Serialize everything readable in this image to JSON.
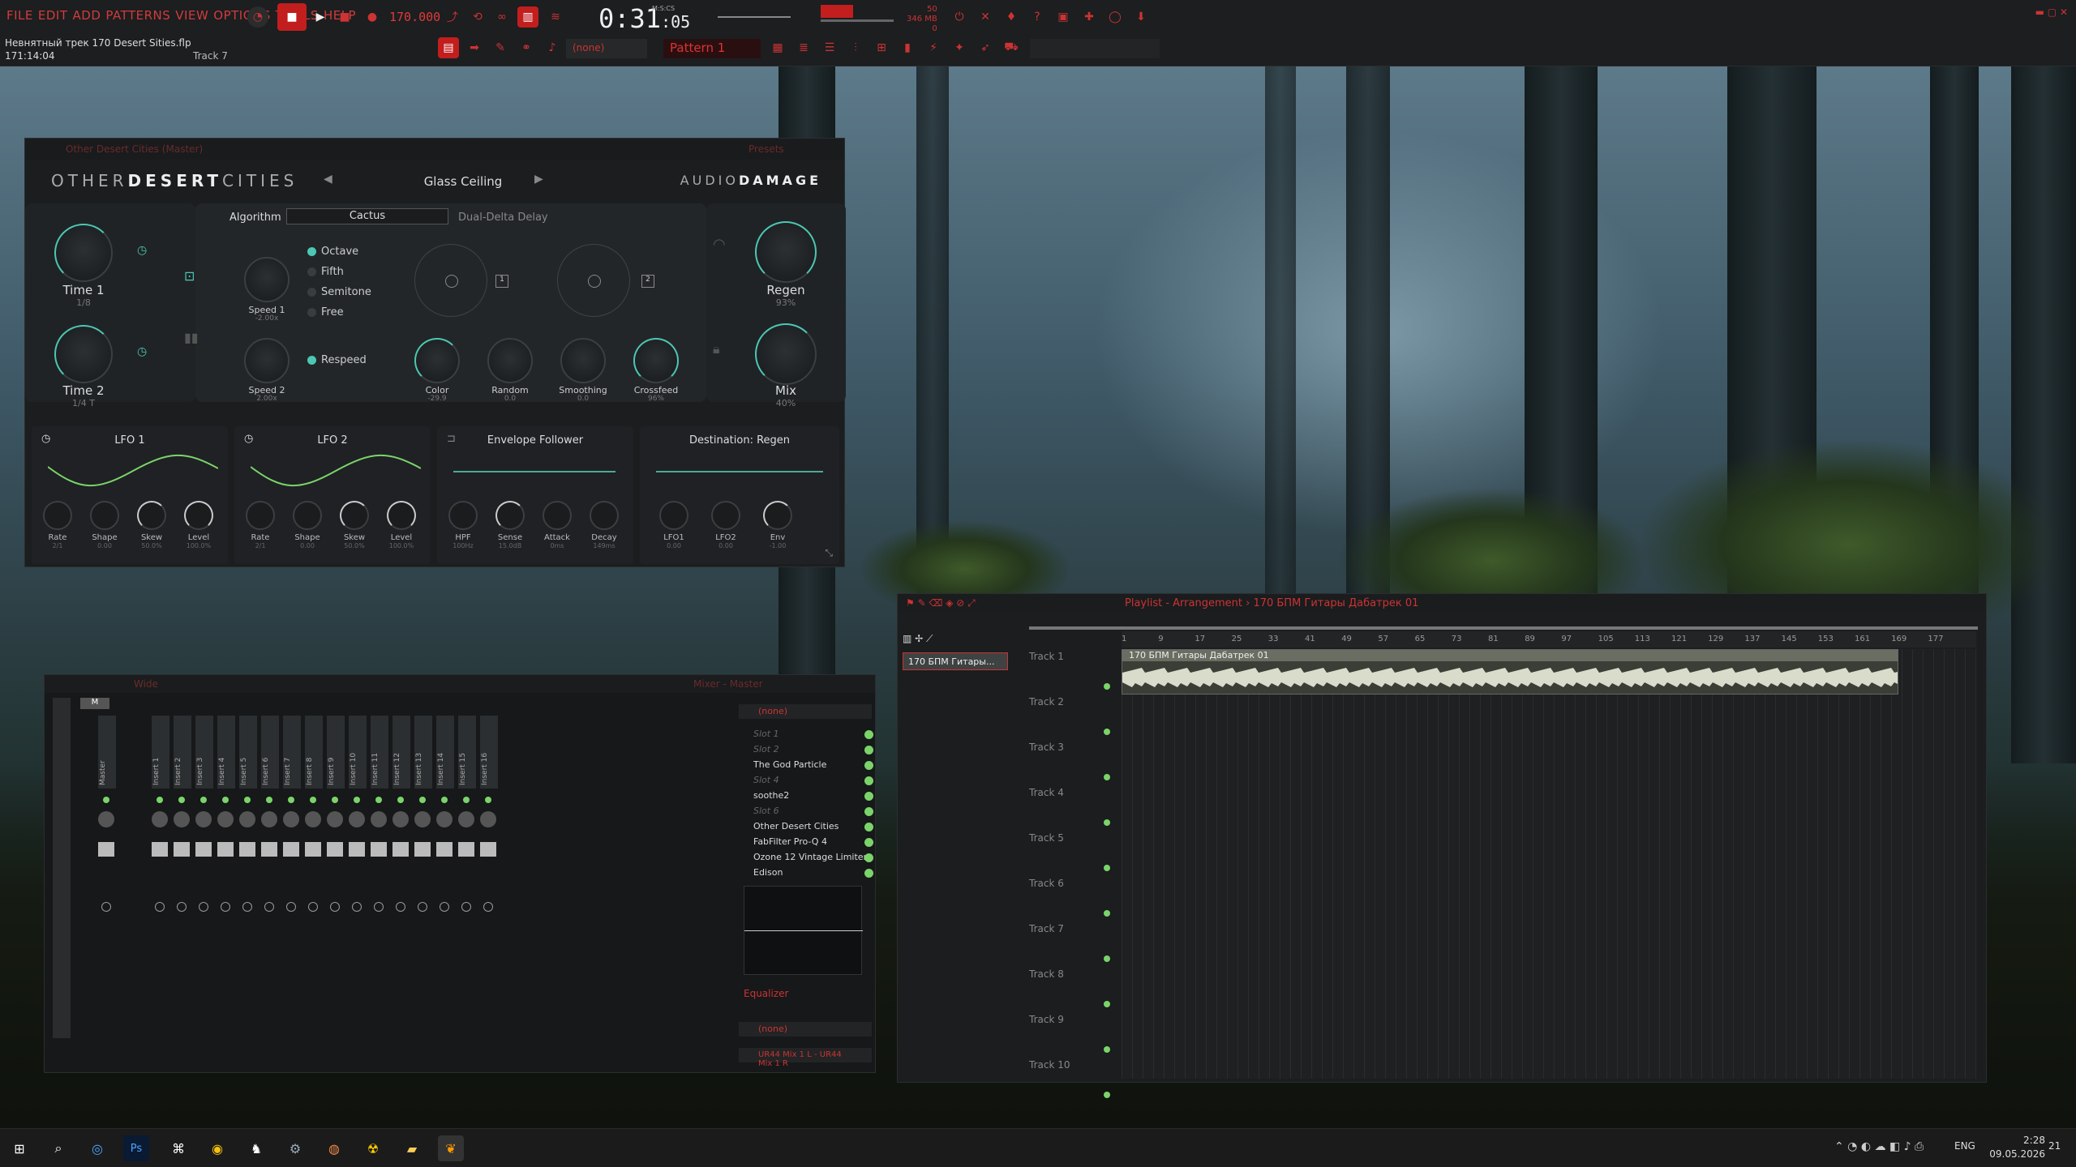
{
  "topbar": {
    "menu": [
      "FILE",
      "EDIT",
      "ADD",
      "PATTERNS",
      "VIEW",
      "OPTIONS",
      "TOOLS",
      "HELP"
    ],
    "project_name": "Невнятный трек 170 Desert Sities.flp",
    "project_time": "171:14:04",
    "track_hint": "Track 7",
    "bpm": "170.000",
    "time_main": "0:31",
    "time_sub": "05",
    "time_label": "M:S:CS",
    "pattern": "Pattern 1",
    "none_label": "(none)",
    "cpu_label": "50",
    "mem_label": "346 MB",
    "mem_val": "0"
  },
  "plugin": {
    "window_title": "Other Desert Cities (Master)",
    "presets_label": "Presets",
    "brand_left_a": "OTHER",
    "brand_left_b": "DESERT",
    "brand_left_c": "CITIES",
    "brand_right_a": "AUDIO",
    "brand_right_b": "DAMAGE",
    "preset_name": "Glass Ceiling",
    "algorithm_label": "Algorithm",
    "algorithm_value": "Cactus",
    "algorithm_desc": "Dual-Delta Delay",
    "time1": {
      "label": "Time 1",
      "value": "1/8"
    },
    "time2": {
      "label": "Time 2",
      "value": "1/4 T"
    },
    "regen": {
      "label": "Regen",
      "value": "93%"
    },
    "mix": {
      "label": "Mix",
      "value": "40%"
    },
    "speed1": {
      "label": "Speed 1",
      "value": "-2.00x"
    },
    "speed2": {
      "label": "Speed 2",
      "value": "2.00x"
    },
    "modes": [
      "Octave",
      "Fifth",
      "Semitone",
      "Free"
    ],
    "mode_selected": "Octave",
    "respeed": "Respeed",
    "pad1": "1",
    "pad2": "2",
    "color": {
      "label": "Color",
      "value": "-29.9"
    },
    "random": {
      "label": "Random",
      "value": "0.0"
    },
    "smoothing": {
      "label": "Smoothing",
      "value": "0.0"
    },
    "crossfeed": {
      "label": "Crossfeed",
      "value": "96%"
    },
    "lfo1": {
      "title": "LFO 1",
      "knobs": [
        [
          "Rate",
          "2/1"
        ],
        [
          "Shape",
          "0.00"
        ],
        [
          "Skew",
          "50.0%"
        ],
        [
          "Level",
          "100.0%"
        ]
      ]
    },
    "lfo2": {
      "title": "LFO 2",
      "knobs": [
        [
          "Rate",
          "2/1"
        ],
        [
          "Shape",
          "0.00"
        ],
        [
          "Skew",
          "50.0%"
        ],
        [
          "Level",
          "100.0%"
        ]
      ]
    },
    "env": {
      "title": "Envelope Follower",
      "knobs": [
        [
          "HPF",
          "100Hz"
        ],
        [
          "Sense",
          "15.0dB"
        ],
        [
          "Attack",
          "0ms"
        ],
        [
          "Decay",
          "149ms"
        ]
      ]
    },
    "dest": {
      "title": "Destination: Regen",
      "knobs": [
        [
          "LFO1",
          "0.00"
        ],
        [
          "LFO2",
          "0.00"
        ],
        [
          "Env",
          "-1.00"
        ]
      ]
    }
  },
  "mixer": {
    "title": "Wide",
    "master_label": "M",
    "strips": [
      "Master",
      "Insert 1",
      "Insert 2",
      "Insert 3",
      "Insert 4",
      "Insert 5",
      "Insert 6",
      "Insert 7",
      "Insert 8",
      "Insert 9",
      "Insert 10",
      "Insert 11",
      "Insert 12",
      "Insert 13",
      "Insert 14",
      "Insert 15",
      "Insert 16"
    ],
    "panel_title": "Mixer - Master",
    "input": "(none)",
    "slots": [
      [
        "Slot 1",
        true
      ],
      [
        "Slot 2",
        true
      ],
      [
        "The God Particle",
        false
      ],
      [
        "Slot 4",
        true
      ],
      [
        "soothe2",
        false
      ],
      [
        "Slot 6",
        true
      ],
      [
        "Other Desert Cities",
        false
      ],
      [
        "FabFilter Pro-Q 4",
        false
      ],
      [
        "Ozone 12 Vintage Limiter",
        false
      ],
      [
        "Edison",
        false
      ]
    ],
    "eq_label": "Equalizer",
    "out_none": "(none)",
    "output": "UR44 Mix 1 L - UR44 Mix 1 R"
  },
  "playlist": {
    "title": "Playlist - Arrangement",
    "clip_name": "170 БПМ Гитары Дабатрек 01",
    "clip_short": "170 БПМ Гитары...",
    "ruler": [
      "1",
      "9",
      "17",
      "25",
      "33",
      "41",
      "49",
      "57",
      "65",
      "73",
      "81",
      "89",
      "97",
      "105",
      "113",
      "121",
      "129",
      "137",
      "145",
      "153",
      "161",
      "169",
      "177"
    ],
    "tracks": [
      "Track 1",
      "Track 2",
      "Track 3",
      "Track 4",
      "Track 5",
      "Track 6",
      "Track 7",
      "Track 8",
      "Track 9",
      "Track 10"
    ]
  },
  "taskbar": {
    "lang": "ENG",
    "time": "2:28",
    "date": "09.05.2026",
    "notif": "21"
  },
  "icons": [
    "windows-icon",
    "search-icon",
    "edge-icon",
    "photoshop-icon",
    "app-icon",
    "chrome-icon",
    "fox-icon",
    "steam-icon",
    "opera-icon",
    "radiation-icon",
    "folder-icon",
    "fl-studio-icon"
  ]
}
